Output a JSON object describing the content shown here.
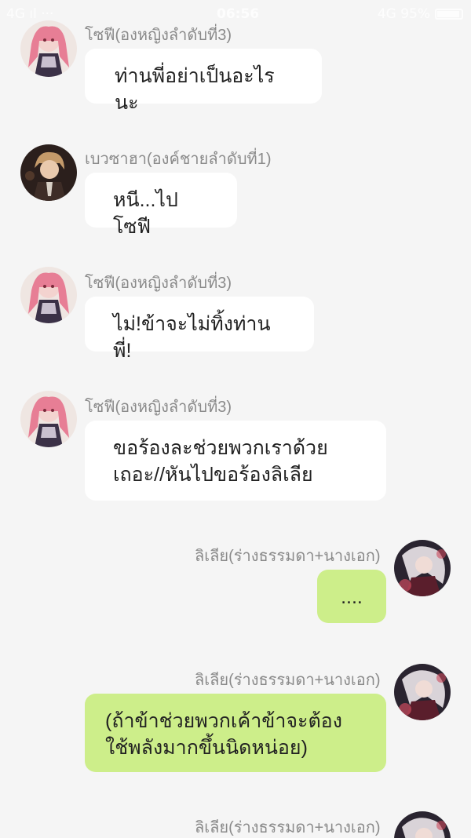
{
  "status": {
    "left": "4G ıl ···",
    "time": "06:56",
    "right": "4G 95%"
  },
  "messages": [
    {
      "sender": "โซฟี(องหญิงลำดับที่3)",
      "lines": [
        "ท่านพี่อย่าเป็นอะไรนะ"
      ],
      "side": "left",
      "avatar": "princess-avatar"
    },
    {
      "sender": "เบวซาฮา(องค์ชายลำดับที่1)",
      "lines": [
        "หนี...ไปโซฟี"
      ],
      "side": "left",
      "avatar": "prince-avatar"
    },
    {
      "sender": "โซฟี(องหญิงลำดับที่3)",
      "lines": [
        "ไม่!ข้าจะไม่ทิ้งท่านพี่!"
      ],
      "side": "left",
      "avatar": "princess-avatar"
    },
    {
      "sender": "โซฟี(องหญิงลำดับที่3)",
      "lines": [
        "ขอร้องละช่วยพวกเราด้วย",
        "เถอะ//หันไปขอร้องลิเลีย"
      ],
      "side": "left",
      "avatar": "princess-avatar"
    },
    {
      "sender": "ลิเลีย(ร่างธรรมดา+นางเอก)",
      "lines": [
        "...."
      ],
      "side": "right",
      "avatar": "heroine-avatar"
    },
    {
      "sender": "ลิเลีย(ร่างธรรมดา+นางเอก)",
      "lines": [
        "(ถ้าข้าช่วยพวกเค้าข้าจะต้อง",
        "ใช้พลังมากขึ้นนิดหน่อย)"
      ],
      "side": "right",
      "avatar": "heroine-avatar"
    },
    {
      "sender": "ลิเลีย(ร่างธรรมดา+นางเอก)",
      "lines": [],
      "side": "right",
      "avatar": "heroine-avatar"
    }
  ],
  "colors": {
    "background": "#f5f5f5",
    "incoming_bubble": "#ffffff",
    "outgoing_bubble": "#cdee8a",
    "sender_text": "#8a8a8a"
  }
}
